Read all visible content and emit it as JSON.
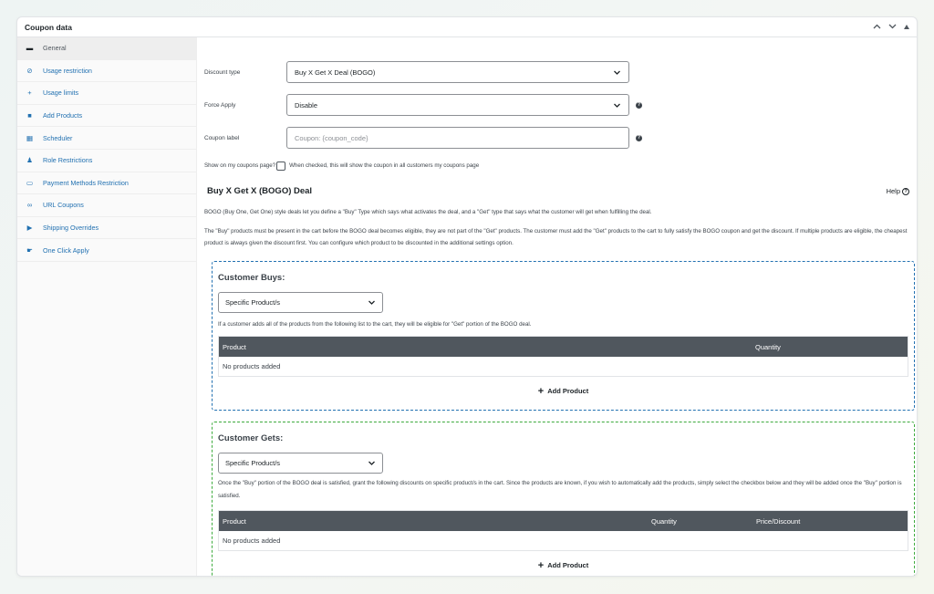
{
  "panel": {
    "title": "Coupon data",
    "controls": [
      "^",
      "v",
      "▲"
    ]
  },
  "sidebar": {
    "items": [
      {
        "label": "General",
        "icon": "ticket-icon",
        "glyph": "▬",
        "active": true
      },
      {
        "label": "Usage restriction",
        "icon": "block-icon",
        "glyph": "⊘",
        "active": false
      },
      {
        "label": "Usage limits",
        "icon": "plus-icon",
        "glyph": "+",
        "active": false
      },
      {
        "label": "Add Products",
        "icon": "bag-icon",
        "glyph": "■",
        "active": false
      },
      {
        "label": "Scheduler",
        "icon": "calendar-icon",
        "glyph": "▦",
        "active": false
      },
      {
        "label": "Role Restrictions",
        "icon": "user-icon",
        "glyph": "♟",
        "active": false
      },
      {
        "label": "Payment Methods Restriction",
        "icon": "card-icon",
        "glyph": "▭",
        "active": false
      },
      {
        "label": "URL Coupons",
        "icon": "link-icon",
        "glyph": "∞",
        "active": false
      },
      {
        "label": "Shipping Overrides",
        "icon": "truck-icon",
        "glyph": "▶",
        "active": false
      },
      {
        "label": "One Click Apply",
        "icon": "pointer-icon",
        "glyph": "☛",
        "active": false
      }
    ]
  },
  "form": {
    "discount_type_label": "Discount type",
    "discount_type_value": "Buy X Get X Deal (BOGO)",
    "force_apply_label": "Force Apply",
    "force_apply_value": "Disable",
    "coupon_label_label": "Coupon label",
    "coupon_label_placeholder": "Coupon: {coupon_code}",
    "show_on_page_label": "Show on my coupons page?",
    "show_on_page_desc": "When checked, this will show the coupon in all customers my coupons page"
  },
  "bogo": {
    "title": "Buy X Get X (BOGO) Deal",
    "help_label": "Help",
    "intro": "BOGO (Buy One, Get One) style deals let you define a \"Buy\" Type which says what activates the deal, and a \"Get\" type that says what the customer will get when fulfilling the deal.",
    "note": "The \"Buy\" products must be present in the cart before the BOGO deal becomes eligible, they are not part of the \"Get\" products. The customer must add the \"Get\" products to the cart to fully satisfy the BOGO coupon and get the discount. If multiple products are eligible, the cheapest product is always given the discount first. You can configure which product to be discounted in the additional settings option."
  },
  "customer_buys": {
    "title": "Customer Buys:",
    "select_value": "Specific Product/s",
    "desc": "If a customer adds all of the products from the following list to the cart, they will be eligible for \"Get\" portion of the BOGO deal.",
    "columns": [
      "Product",
      "Quantity"
    ],
    "empty": "No products added",
    "add_label": "Add Product"
  },
  "customer_gets": {
    "title": "Customer Gets:",
    "select_value": "Specific Product/s",
    "desc": "Once the \"Buy\" portion of the BOGO deal is satisfied, grant the following discounts on specific product/s in the cart. Since the products are known, if you wish to automatically add the products, simply select the checkbox below and they will be added once the \"Buy\" portion is satisfied.",
    "columns": [
      "Product",
      "Quantity",
      "Price/Discount"
    ],
    "empty": "No products added",
    "add_label": "Add Product"
  },
  "colors": {
    "accent": "#2271b1",
    "table_header": "#50575e",
    "buys_border": "#2271b1",
    "gets_border": "#3dab3d"
  }
}
